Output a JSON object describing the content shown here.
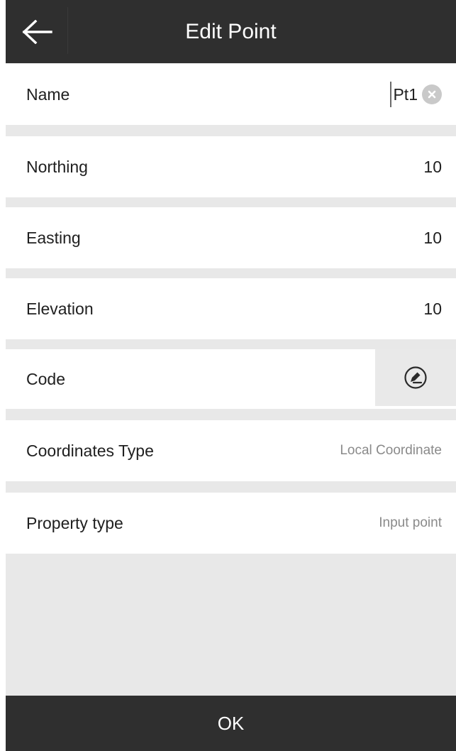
{
  "header": {
    "title": "Edit Point",
    "back_icon": "arrow-left-icon"
  },
  "fields": {
    "name": {
      "label": "Name",
      "value": "Pt1",
      "clear_icon": "clear-circle-icon"
    },
    "northing": {
      "label": "Northing",
      "value": "10"
    },
    "easting": {
      "label": "Easting",
      "value": "10"
    },
    "elevation": {
      "label": "Elevation",
      "value": "10"
    },
    "code": {
      "label": "Code",
      "button_icon": "edit-pen-icon"
    },
    "coordinates_type": {
      "label": "Coordinates Type",
      "value": "Local Coordinate"
    },
    "property_type": {
      "label": "Property type",
      "value": "Input point"
    }
  },
  "footer": {
    "ok_label": "OK"
  },
  "colors": {
    "header_bg": "#2f2f2f",
    "page_bg": "#e8e8e8",
    "row_bg": "#ffffff"
  }
}
